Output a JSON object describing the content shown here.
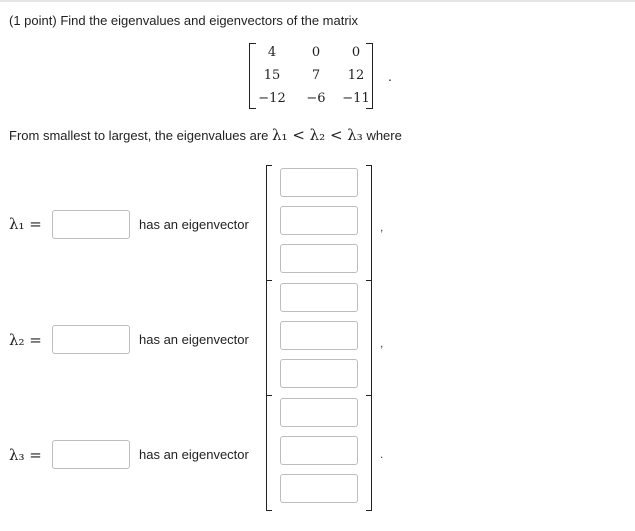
{
  "problem": {
    "points": "(1 point)",
    "prompt": "Find the eigenvalues and eigenvectors of the matrix",
    "matrix": [
      [
        "4",
        "0",
        "0"
      ],
      [
        "15",
        "7",
        "12"
      ],
      [
        "−12",
        "−6",
        "−11"
      ]
    ],
    "matrix_end": ".",
    "ordering_text": "From smallest to largest, the eigenvalues are",
    "ordering_math": "λ₁ < λ₂ < λ₃",
    "ordering_end": "where"
  },
  "rows": [
    {
      "lambda": "λ₁ =",
      "eigenvalue": "",
      "phrase": "has an eigenvector",
      "vector": [
        "",
        "",
        ""
      ],
      "end_punct": ","
    },
    {
      "lambda": "λ₂ =",
      "eigenvalue": "",
      "phrase": "has an eigenvector",
      "vector": [
        "",
        "",
        ""
      ],
      "end_punct": ","
    },
    {
      "lambda": "λ₃ =",
      "eigenvalue": "",
      "phrase": "has an eigenvector",
      "vector": [
        "",
        "",
        ""
      ],
      "end_punct": "."
    }
  ]
}
